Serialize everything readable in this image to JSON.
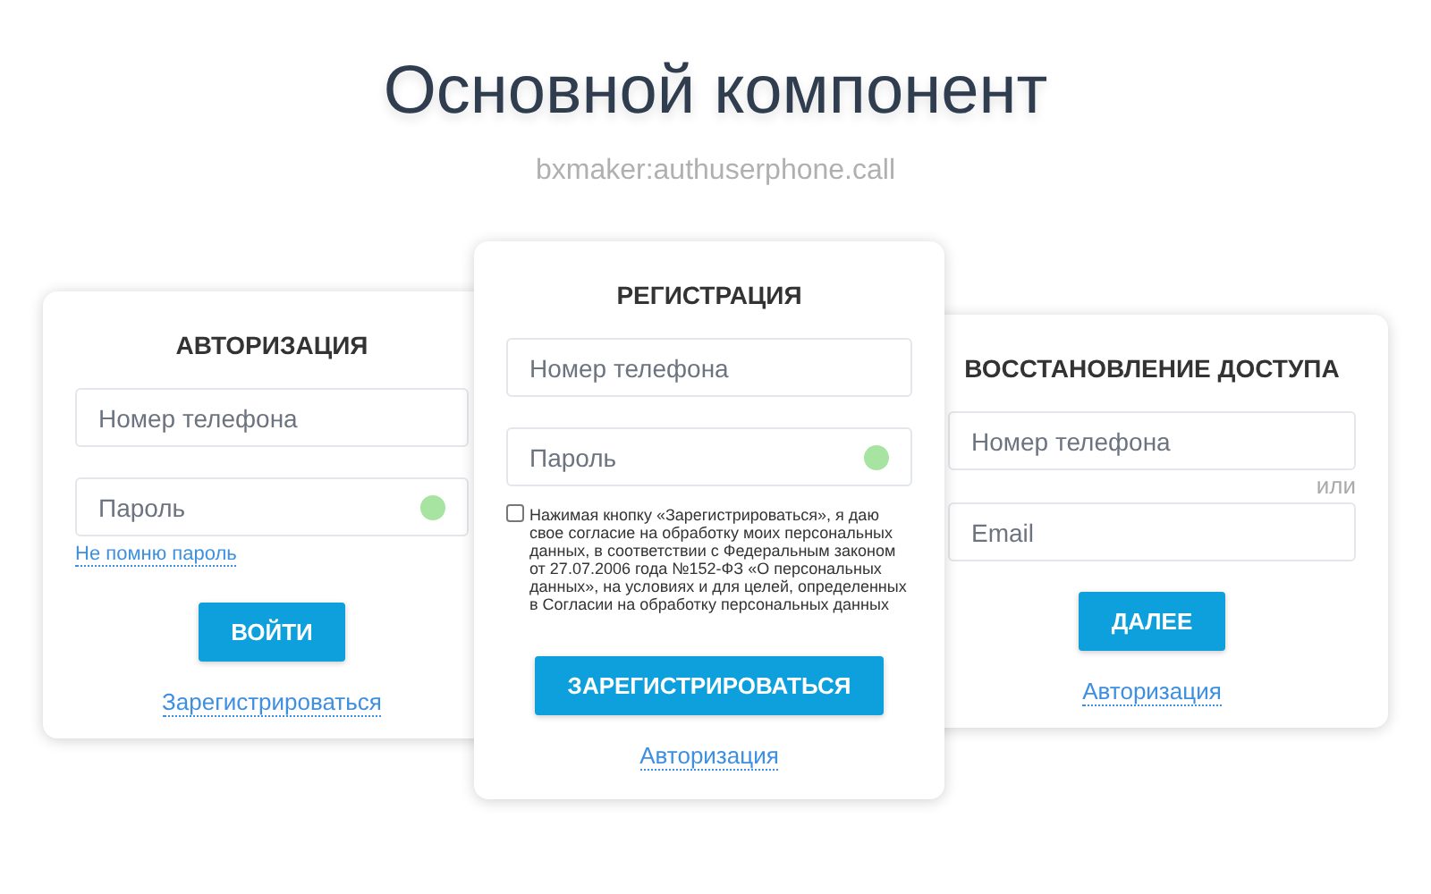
{
  "header": {
    "title": "Основной компонент",
    "subtitle": "bxmaker:authuserphone.call"
  },
  "cards": [
    {
      "title": "АВТОРИЗАЦИЯ",
      "items": [
        {
          "kind": "field",
          "placeholder": "Номер телефона"
        },
        {
          "kind": "password",
          "placeholder": "Пароль"
        },
        {
          "kind": "small-link",
          "text": "Не помню пароль"
        },
        {
          "kind": "button",
          "text": "ВОЙТИ"
        },
        {
          "kind": "link",
          "text": "Зарегистрироваться"
        }
      ]
    },
    {
      "title": "РЕГИСТРАЦИЯ",
      "items": [
        {
          "kind": "field",
          "placeholder": "Номер телефона"
        },
        {
          "kind": "password",
          "placeholder": "Пароль"
        },
        {
          "kind": "consent",
          "checked": false,
          "text": "Нажимая кнопку «Зарегистрироваться», я даю свое согласие на обработку моих персональных данных, в соответствии с Федеральным законом от 27.07.2006 года №152-ФЗ «О персональных данных», на условиях и для целей, определенных в Согласии на обработку персональных данных"
        },
        {
          "kind": "button",
          "text": "ЗАРЕГИСТРИРОВАТЬСЯ"
        },
        {
          "kind": "link",
          "text": "Авторизация"
        }
      ]
    },
    {
      "title": "ВОССТАНОВЛЕНИЕ ДОСТУПА",
      "items": [
        {
          "kind": "field",
          "placeholder": "Номер телефона"
        },
        {
          "kind": "separator",
          "text": "или"
        },
        {
          "kind": "field",
          "placeholder": "Email"
        },
        {
          "kind": "button",
          "text": "ДАЛЕЕ"
        },
        {
          "kind": "link",
          "text": "Авторизация"
        }
      ]
    }
  ]
}
